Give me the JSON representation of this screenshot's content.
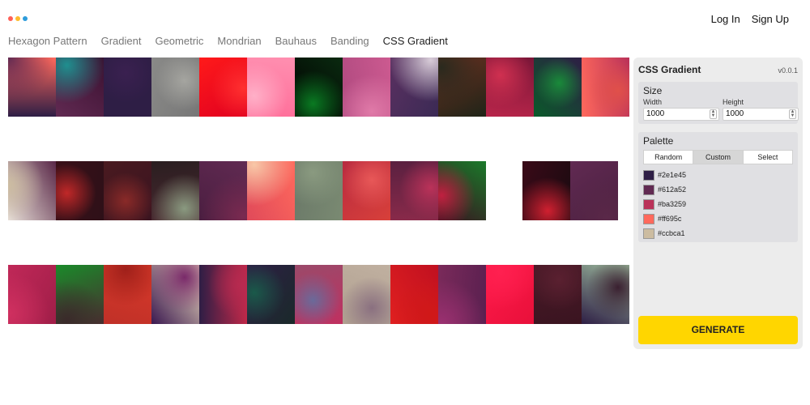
{
  "window_dots": [
    {
      "name": "red",
      "color": "#ff5f57"
    },
    {
      "name": "yellow",
      "color": "#febc2e"
    },
    {
      "name": "blue",
      "color": "#2d9cdb"
    }
  ],
  "auth": {
    "login": "Log In",
    "signup": "Sign Up"
  },
  "nav": {
    "tabs": [
      "Hexagon Pattern",
      "Gradient",
      "Geometric",
      "Mondrian",
      "Bauhaus",
      "Banding",
      "CSS Gradient"
    ],
    "active": "CSS Gradient"
  },
  "gallery_rows": [
    [
      [
        "#2e1e45",
        "#612a52",
        "#ff695c"
      ],
      [
        "#612a52",
        "#1f8f8f",
        "#3a1030"
      ],
      [
        "#2e1e45",
        "#3a2050",
        "#2e1e45"
      ],
      [
        "#8a8a88",
        "#a5a5a0",
        "#777"
      ],
      [
        "#ff1a1a",
        "#ff3030",
        "#e00020"
      ],
      [
        "#ff8fb0",
        "#ffb0c8",
        "#ff6f9a"
      ],
      [
        "#0a2a10",
        "#0a7a22",
        "#000"
      ],
      [
        "#cc5a90",
        "#e07aa8",
        "#b04a80"
      ],
      [
        "#3b2a55",
        "#d8ccd8",
        "#5a3060"
      ],
      [
        "#1f2418",
        "#2a2a1e",
        "#6a3020"
      ],
      [
        "#b8254a",
        "#d03050",
        "#7a1638"
      ],
      [
        "#0a5a2a",
        "#1a8a3a",
        "#2e1e45"
      ],
      [
        "#ff695c",
        "#e0504a",
        "#ba3259"
      ]
    ],
    [
      [
        "#e8e0d8",
        "#ccbca1",
        "#5a2848"
      ],
      [
        "#3a1018",
        "#c02828",
        "#2e1018"
      ],
      [
        "#4a1a20",
        "#8a2a28",
        "#3a1420"
      ],
      [
        "#2a1e20",
        "#8a9a80",
        "#4a2830"
      ],
      [
        "#612a52",
        "#7a2a50",
        "#4a1e40"
      ],
      [
        "#ff695c",
        "#f8c8a8",
        "#e04a5a"
      ],
      [
        "#7a8a72",
        "#8a9a80",
        "#6a7868"
      ],
      [
        "#d8403a",
        "#e85858",
        "#b82a40"
      ],
      [
        "#8a2a4a",
        "#ba3259",
        "#5a2040"
      ],
      [
        "#3a1020",
        "#c02040",
        "#1a7a2a"
      ],
      null,
      [
        "#3a0a18",
        "#d02030",
        "#1a0a10"
      ],
      [
        "#612a52",
        "#5a2848",
        "#4a2040"
      ]
    ],
    [
      [
        "#c02858",
        "#d03060",
        "#a01e48"
      ],
      [
        "#1a8a2a",
        "#3a2a2a",
        "#4a2e30"
      ],
      [
        "#d83a2a",
        "#a0201a",
        "#c03028"
      ],
      [
        "#f0e0c0",
        "#7a2a6a",
        "#3a1850"
      ],
      [
        "#c02848",
        "#b82a50",
        "#2e1e45"
      ],
      [
        "#1a2a2a",
        "#1a5a4a",
        "#2e1e45"
      ],
      [
        "#c03060",
        "#6a6a9a",
        "#9a4a6a"
      ],
      [
        "#b0a090",
        "#8a7080",
        "#c0b0a0"
      ],
      [
        "#e02020",
        "#d01818",
        "#c01020"
      ],
      [
        "#7a2a5a",
        "#9a3070",
        "#5a2050"
      ],
      [
        "#ff1a4a",
        "#ff2050",
        "#e8103a"
      ],
      [
        "#4a1a28",
        "#5a2030",
        "#3a1420"
      ],
      [
        "#a0c0a0",
        "#3a2030",
        "#2e1e45"
      ]
    ]
  ],
  "panel": {
    "title": "CSS Gradient",
    "version": "v0.0.1",
    "size": {
      "title": "Size",
      "width_label": "Width",
      "width_value": "1000",
      "height_label": "Height",
      "height_value": "1000"
    },
    "palette": {
      "title": "Palette",
      "modes": [
        "Random",
        "Custom",
        "Select"
      ],
      "active_mode": "Custom",
      "colors": [
        "#2e1e45",
        "#612a52",
        "#ba3259",
        "#ff695c",
        "#ccbca1"
      ]
    },
    "generate_label": "GENERATE"
  }
}
